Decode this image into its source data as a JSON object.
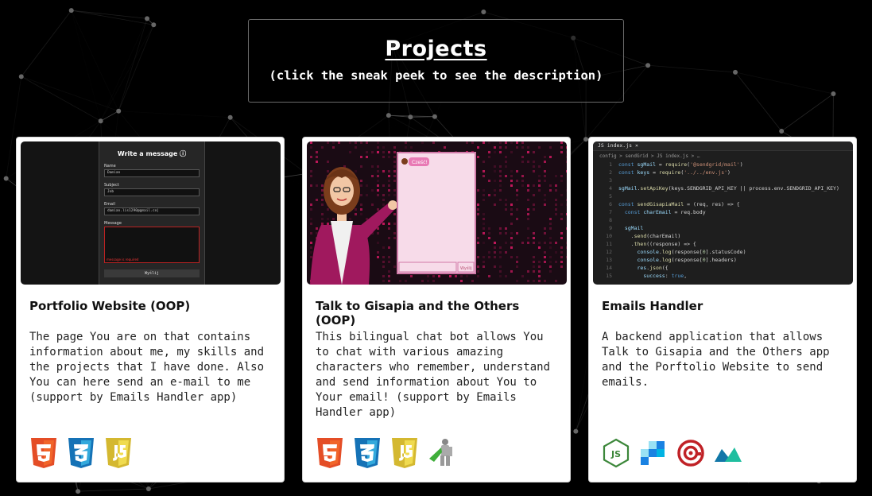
{
  "header": {
    "title": "Projects",
    "subtitle": "(click the sneak peek to see the description)"
  },
  "projects": [
    {
      "title": "Portfolio Website (OOP)",
      "description": "The page You are on that contains information about me, my skills and the projects that I have done. Also You can here send an e-mail to me (support by Emails Handler app)",
      "preview": {
        "form_title": "Write a message ⓘ",
        "name_label": "Name",
        "name_value": "Damian",
        "subject_label": "Subject",
        "subject_value": "Job",
        "email_label": "Email",
        "email_value": "damian.lis1290@gmail.co|",
        "message_label": "Message",
        "error_text": "message is required",
        "button_label": "Wyślij"
      },
      "techs": [
        "html5-icon",
        "css3-icon",
        "javascript-icon"
      ]
    },
    {
      "title": "Talk to Gisapia and the Others (OOP)",
      "description": "This bilingual chat bot allows You to chat with various amazing characters who remember, understand and send information about You to Your email! (support by Emails Handler app)",
      "preview": {
        "bubble_text": "Cześć!",
        "send_label": "Wyślij"
      },
      "techs": [
        "html5-icon",
        "css3-icon",
        "javascript-icon",
        "hero-icon"
      ]
    },
    {
      "title": "Emails Handler",
      "description": "A backend application that allows Talk to Gisapia and the Others app and the Porftolio Website to send emails.",
      "preview": {
        "tab": "JS index.js  ×",
        "breadcrumb": "config > sendGrid > JS index.js > …"
      },
      "techs": [
        "nodejs-icon",
        "sendgrid-icon",
        "mailgun-icon",
        "mailjet-icon"
      ]
    }
  ],
  "colors": {
    "background": "#000000",
    "card": "#ffffff",
    "html5": "#e44d26",
    "css3": "#1572b6",
    "javascript": "#f0db4f",
    "nodejs": "#3c873a",
    "sendgrid": "#1a82e2",
    "mailgun": "#c02126",
    "mailjet": "#1fbe9f",
    "chat_pink": "#f4c6de"
  }
}
